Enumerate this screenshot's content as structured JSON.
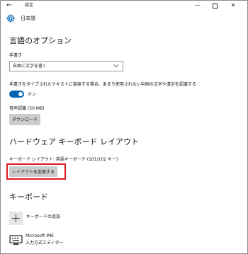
{
  "window": {
    "title": "設定",
    "back_icon": "back-arrow-icon",
    "controls": {
      "minimize_icon": "minimize-icon",
      "maximize_icon": "maximize-icon",
      "close_icon": "close-icon"
    }
  },
  "header": {
    "icon": "gear-icon",
    "title": "日本語"
  },
  "language_options": {
    "title": "言語のオプション",
    "handwriting": {
      "label": "手書き",
      "selected": "自由に文字を書く",
      "dropdown_icon": "chevron-down-icon"
    },
    "auto_convert": {
      "label": "手書きをタイプされたテキストに変換する場合、あまり使用されない中国の文字や漢字を認識する",
      "toggle_state": "オン",
      "toggle_on": true,
      "toggle_color": "#0063b1"
    },
    "speech": {
      "label": "音声認識 (50 MB)",
      "button": "ダウンロード"
    }
  },
  "hardware_keyboard": {
    "title": "ハードウェア キーボード レイアウト",
    "current_layout": "キーボード レイアウト: 英語キーボード (101/102 キー)",
    "button": "レイアウトを変更する",
    "highlight_color": "#e0191e"
  },
  "keyboards": {
    "title": "キーボード",
    "add_label": "キーボードの追加",
    "add_icon": "plus-icon",
    "items": [
      {
        "icon": "keyboard-icon",
        "name": "Microsoft IME",
        "subtitle": "入力方式エディター"
      }
    ]
  }
}
